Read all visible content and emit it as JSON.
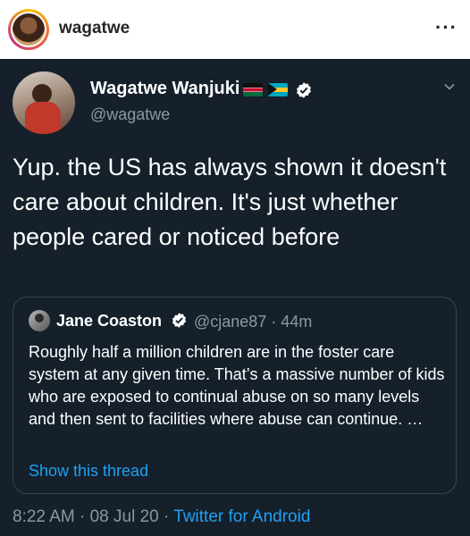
{
  "instagram": {
    "username": "wagatwe",
    "more_icon": "more-horizontal-icon"
  },
  "tweet": {
    "author_name": "Wagatwe Wanjuki",
    "author_handle": "@wagatwe",
    "flags": [
      "kenya-flag-icon",
      "bahamas-flag-icon"
    ],
    "verified_icon": "verified-badge-icon",
    "text": "Yup. the US has always shown it doesn't care about children. It's just whether people cared or noticed before",
    "time": "8:22 AM",
    "date": "08 Jul 20",
    "source": "Twitter for Android",
    "separator": "·"
  },
  "quoted": {
    "author_name": "Jane Coaston",
    "author_handle": "@cjane87",
    "age": "44m",
    "text": "Roughly half a million children are in the foster care system at any given time. That’s a massive number of kids who are exposed to continual abuse on so many levels and then sent to facilities where abuse can continue. …",
    "thread_link": "Show this thread"
  },
  "colors": {
    "tweet_bg": "#15202b",
    "secondary_text": "#8899a6",
    "link": "#1da1f2",
    "border": "#38444d"
  }
}
